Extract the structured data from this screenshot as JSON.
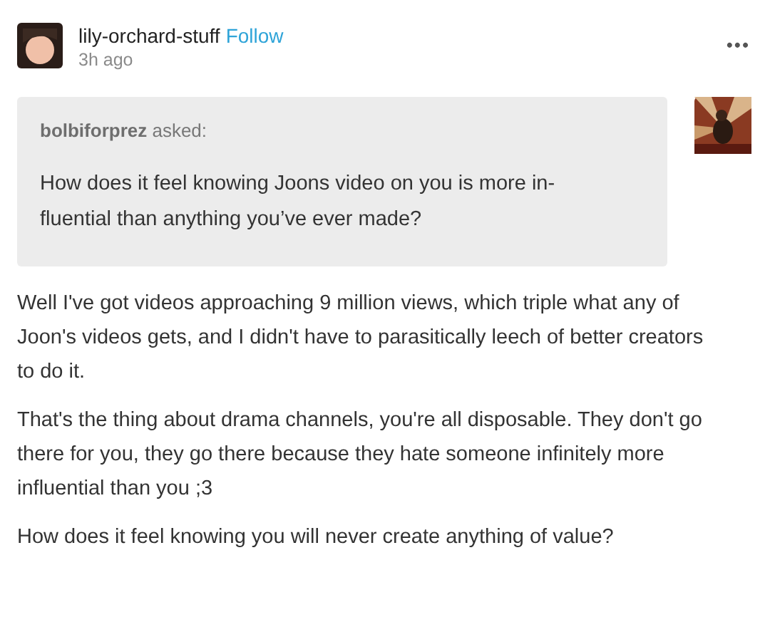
{
  "post": {
    "author": "lily-orchard-stuff",
    "follow": "Follow",
    "time": "3h ago",
    "menu": "•••"
  },
  "ask": {
    "asker": "bolbiforprez",
    "verb": "asked:",
    "question_lines": [
      "How does it feel knowing Joons video on you is  more in-",
      "fluential than anything you’ve ever made?"
    ],
    "asker_avatar": {
      "kind": "picture"
    }
  },
  "answer": [
    "Well I've got videos approaching 9 million views, which triple what any of Joon's videos gets, and I didn't have to parasitically leech of better creators to do it.",
    "That's the thing about drama channels, you're all disposable. They don't go there for you, they go there because they hate someone infinitely more influential than you ;3",
    "How does it feel knowing you will never create anything of value?"
  ]
}
